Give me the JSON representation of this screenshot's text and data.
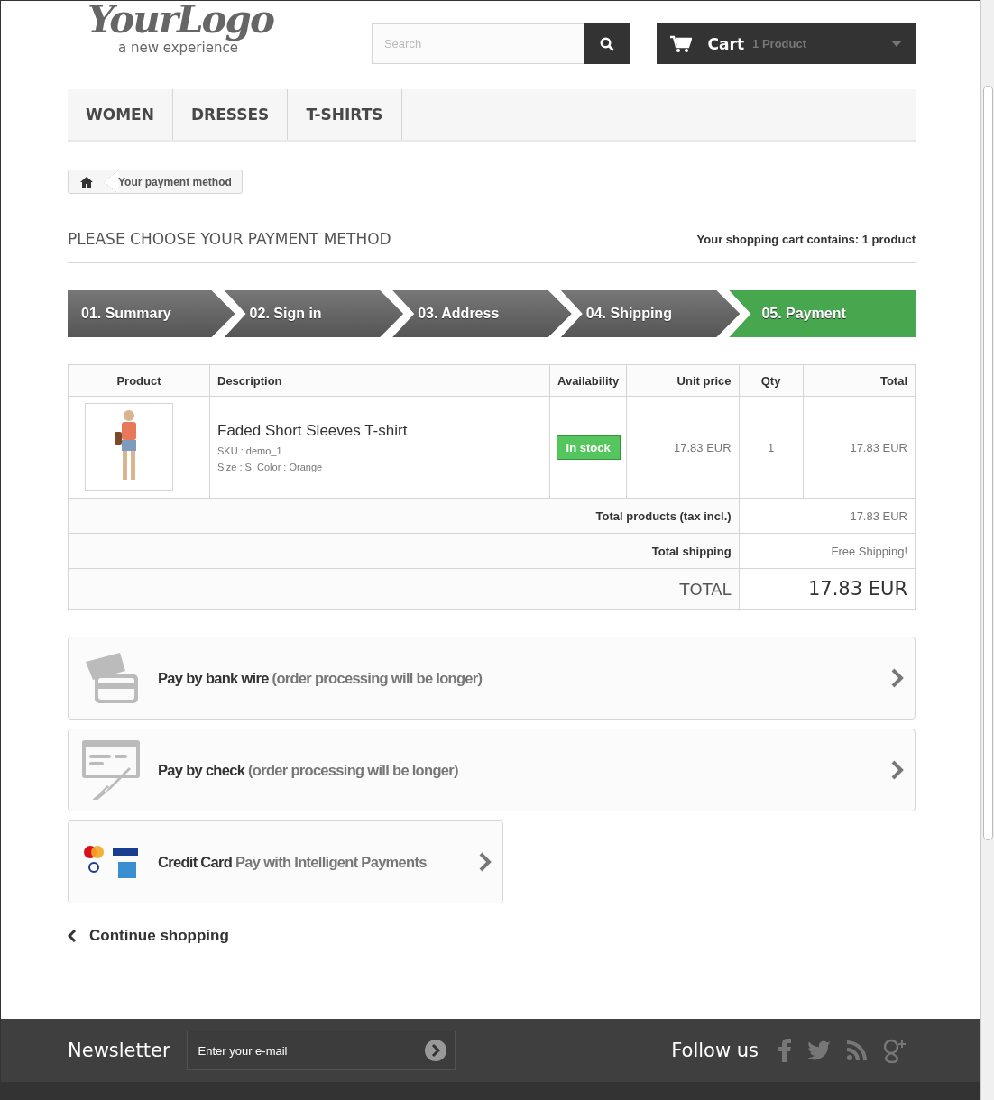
{
  "header": {
    "logo": {
      "title": "YourLogo",
      "tagline": "a new experience"
    },
    "search": {
      "placeholder": "Search"
    },
    "cart": {
      "label": "Cart",
      "count": "1 Product"
    }
  },
  "nav": [
    {
      "label": "WOMEN"
    },
    {
      "label": "DRESSES"
    },
    {
      "label": "T-SHIRTS"
    }
  ],
  "breadcrumb": {
    "current": "Your payment method"
  },
  "page_title": "PLEASE CHOOSE YOUR PAYMENT METHOD",
  "cart_summary": "Your shopping cart contains: 1 product",
  "steps": [
    {
      "label": "01. Summary",
      "selected": false
    },
    {
      "label": "02. Sign in",
      "selected": false
    },
    {
      "label": "03. Address",
      "selected": false
    },
    {
      "label": "04. Shipping",
      "selected": false
    },
    {
      "label": "05. Payment",
      "selected": true
    }
  ],
  "table": {
    "columns": [
      "Product",
      "Description",
      "Availability",
      "Unit price",
      "Qty",
      "Total"
    ],
    "rows": [
      {
        "name": "Faded Short Sleeves T-shirt",
        "sku": "SKU : demo_1",
        "attributes": "Size : S, Color : Orange",
        "availability": "In stock",
        "unit_price": "17.83 EUR",
        "qty": "1",
        "total": "17.83 EUR"
      }
    ],
    "totals": [
      {
        "kind": "line",
        "label": "Total products (tax incl.)",
        "value": "17.83 EUR"
      },
      {
        "kind": "line",
        "label": "Total shipping",
        "value": "Free Shipping!"
      },
      {
        "kind": "grand",
        "label": "TOTAL",
        "value": "17.83 EUR"
      }
    ]
  },
  "payment_options": [
    {
      "kind": "bank",
      "title": "Pay by bank wire",
      "note": "(order processing will be longer)"
    },
    {
      "kind": "check",
      "title": "Pay by check",
      "note": "(order processing will be longer)"
    },
    {
      "kind": "card",
      "title": "Credit Card",
      "note": "Pay with Intelligent Payments"
    }
  ],
  "continue_link": "Continue shopping",
  "footer": {
    "newsletter": {
      "title": "Newsletter",
      "placeholder": "Enter your e-mail"
    },
    "follow": {
      "title": "Follow us"
    }
  }
}
